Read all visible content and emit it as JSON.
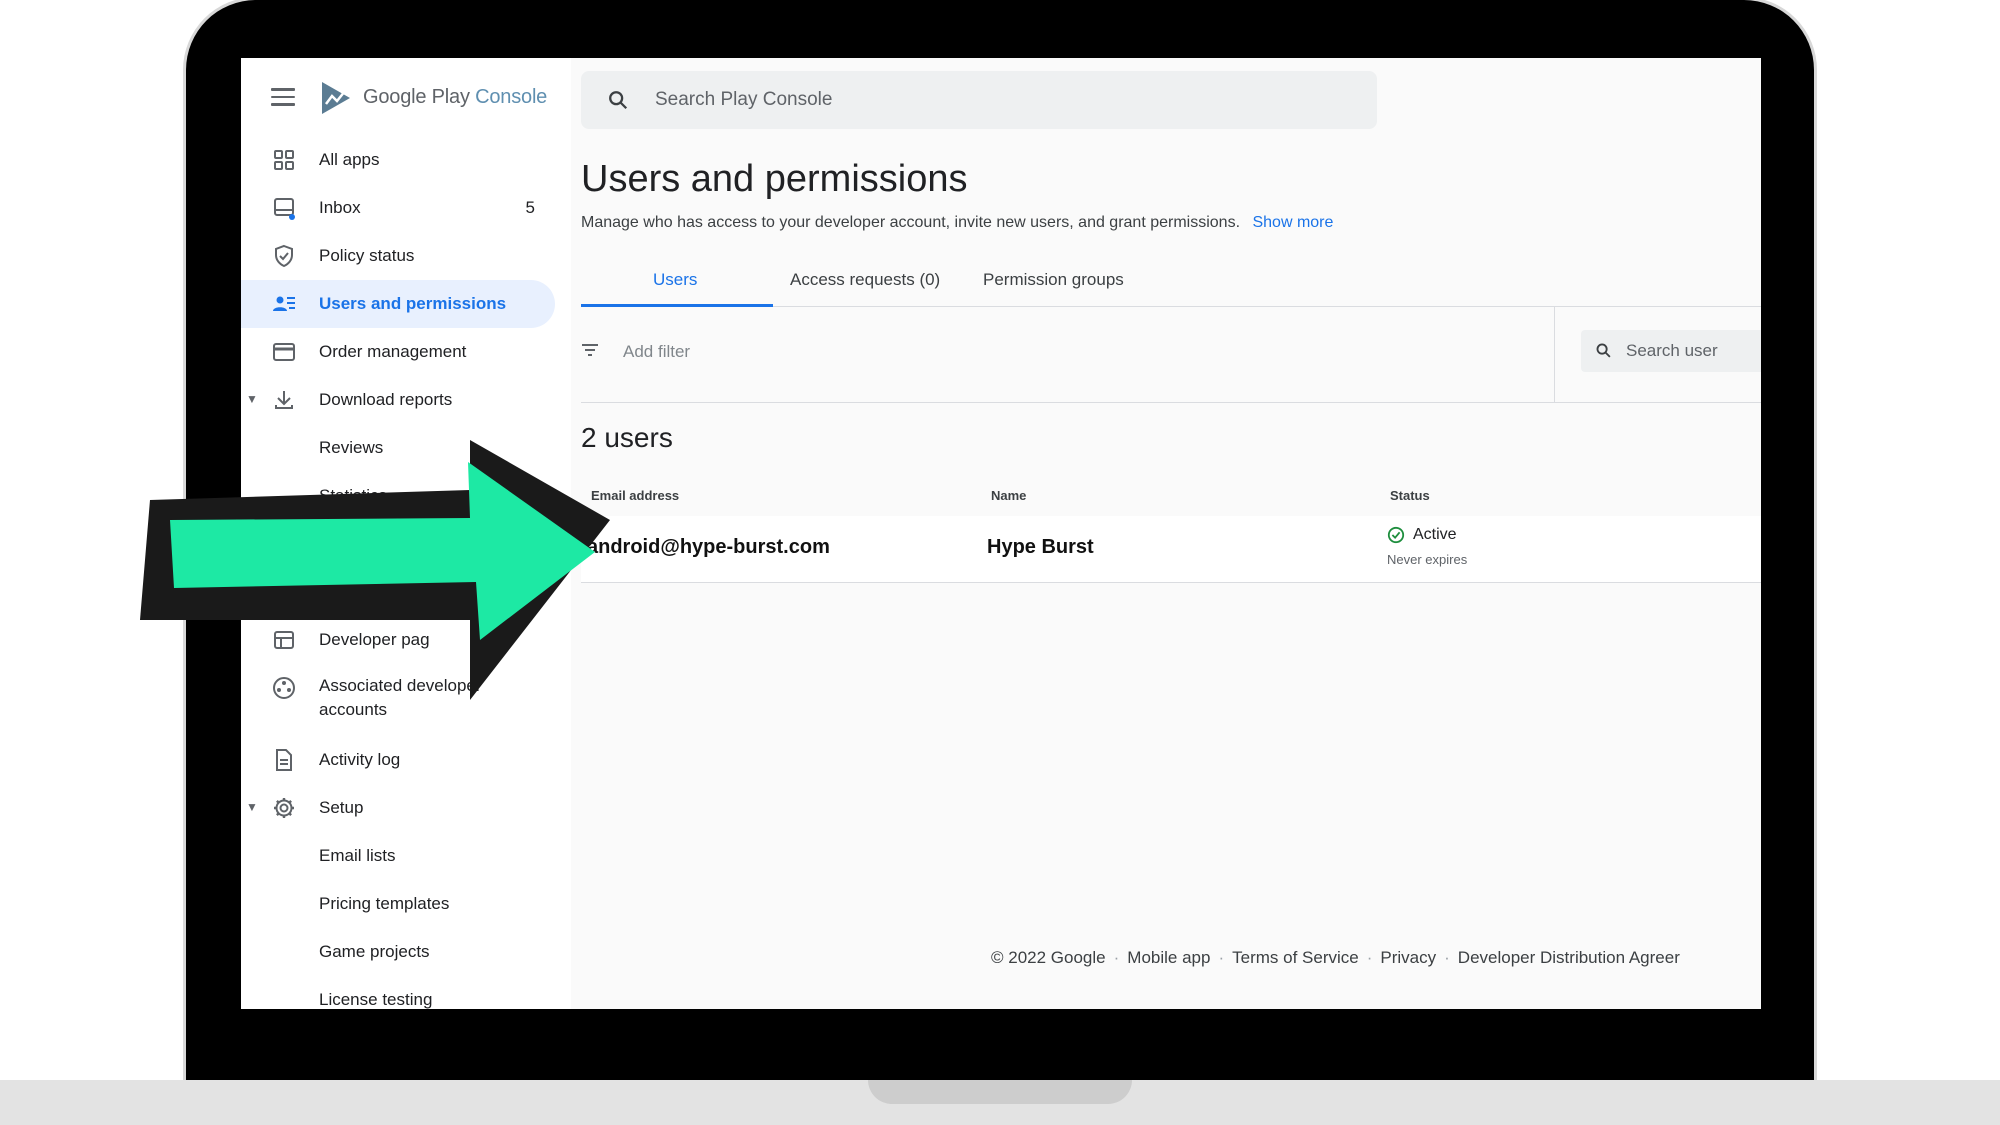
{
  "app": {
    "logo_text_main": "Google Play",
    "logo_text_accent": "Console"
  },
  "search": {
    "placeholder": "Search Play Console"
  },
  "sidebar": {
    "items": [
      {
        "label": "All apps",
        "icon": "grid-icon"
      },
      {
        "label": "Inbox",
        "icon": "inbox-icon",
        "badge": "5"
      },
      {
        "label": "Policy status",
        "icon": "shield-icon"
      },
      {
        "label": "Users and permissions",
        "icon": "manage-accounts-icon",
        "active": true
      },
      {
        "label": "Order management",
        "icon": "credit-card-icon"
      },
      {
        "label": "Download reports",
        "icon": "download-icon",
        "expanded": true
      },
      {
        "label": "Reviews"
      },
      {
        "label": "Statistics"
      },
      {
        "label": "Developer pag",
        "icon": "web-icon"
      },
      {
        "label": "Associated developer accounts",
        "icon": "hub-icon"
      },
      {
        "label": "Activity log",
        "icon": "document-icon"
      },
      {
        "label": "Setup",
        "icon": "gear-icon",
        "expanded": true
      },
      {
        "label": "Email lists"
      },
      {
        "label": "Pricing templates"
      },
      {
        "label": "Game projects"
      },
      {
        "label": "License testing"
      }
    ]
  },
  "page": {
    "title": "Users and permissions",
    "description": "Manage who has access to your developer account, invite new users, and grant permissions.",
    "show_more": "Show more",
    "tabs": [
      "Users",
      "Access requests (0)",
      "Permission groups"
    ],
    "filter_label": "Add filter",
    "user_search_placeholder": "Search user",
    "user_count": "2 users",
    "table": {
      "headers": [
        "Email address",
        "Name",
        "Status"
      ],
      "rows": [
        {
          "email": "android@hype-burst.com",
          "name": "Hype Burst",
          "status": "Active",
          "status_sub": "Never expires"
        }
      ]
    }
  },
  "footer": {
    "copyright": "© 2022 Google",
    "links": [
      "Mobile app",
      "Terms of Service",
      "Privacy",
      "Developer Distribution Agreer"
    ]
  },
  "colors": {
    "accent": "#1a73e8",
    "active_bg": "#e8f0fe",
    "arrow_fill": "#1de9a4",
    "status_ok": "#1e8e3e"
  }
}
